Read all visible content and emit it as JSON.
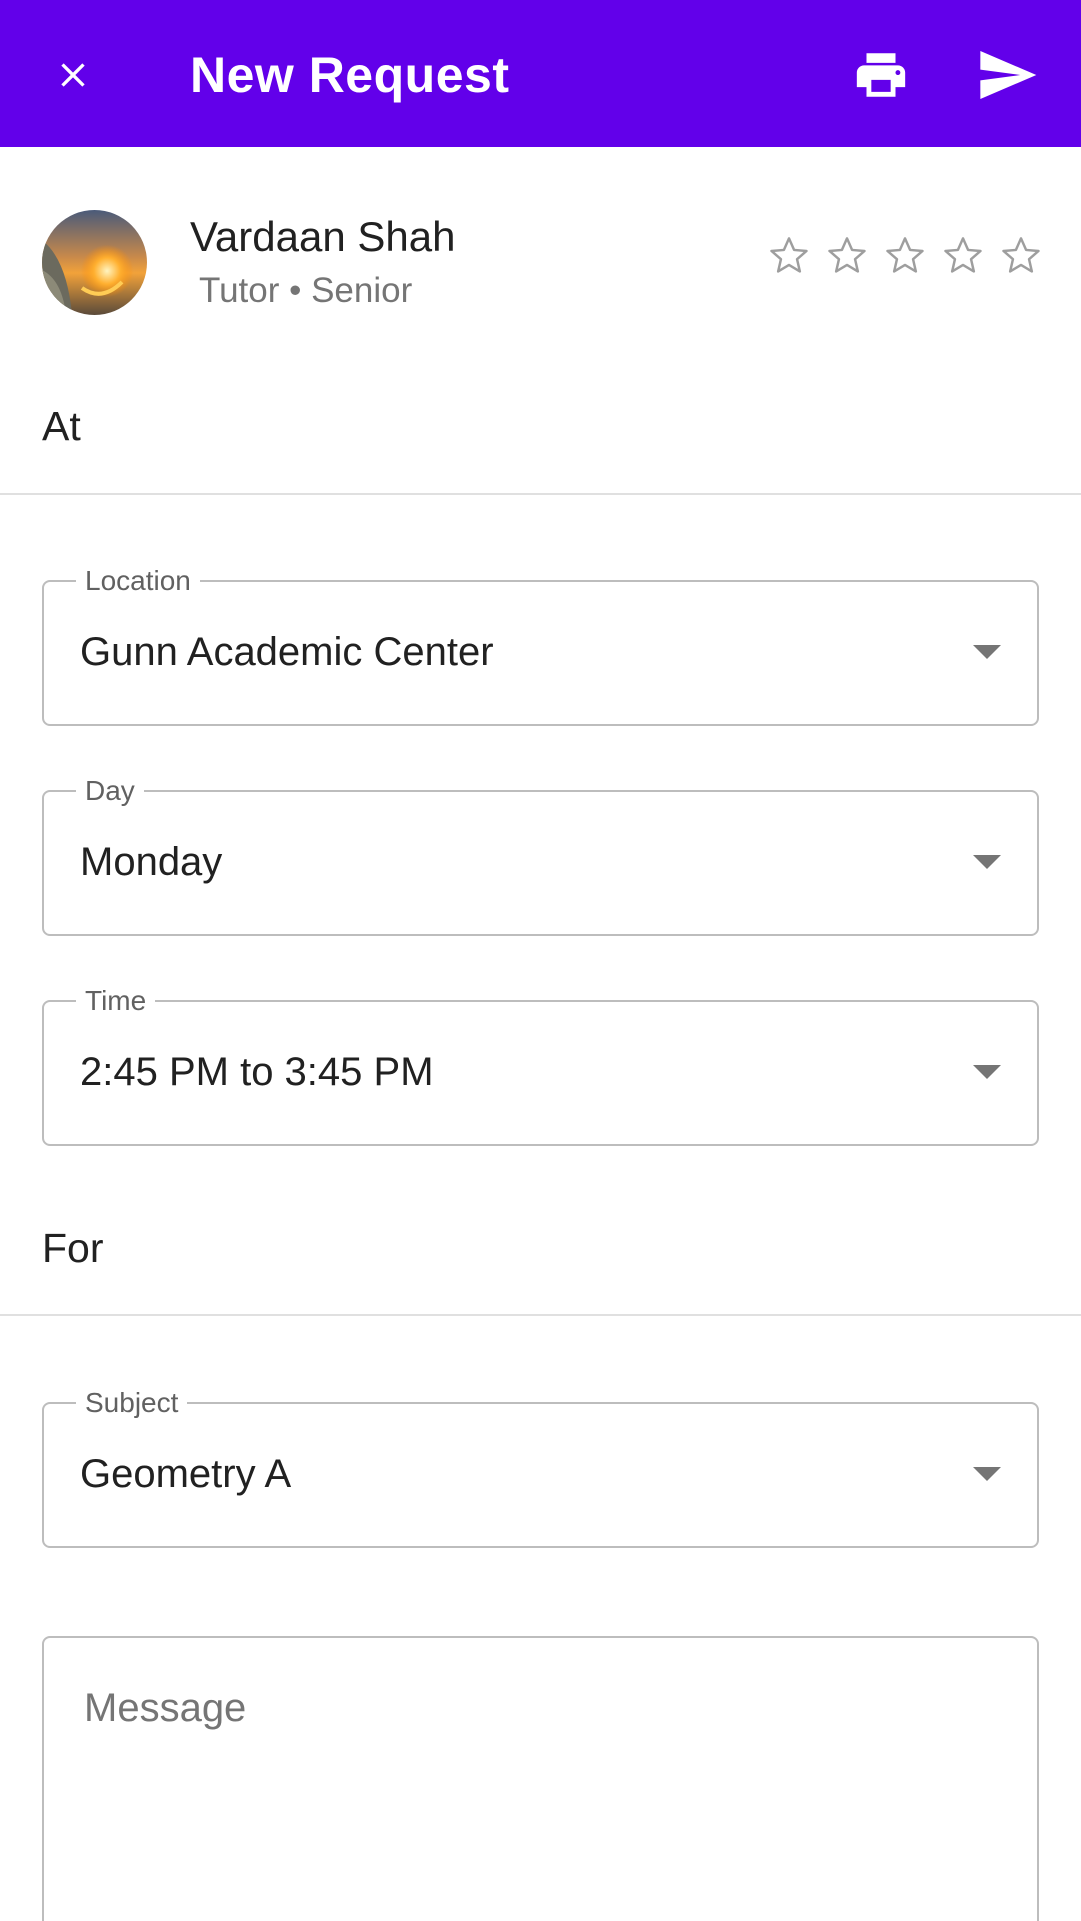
{
  "appbar": {
    "title": "New Request",
    "close_icon": "close-icon",
    "print_icon": "print-icon",
    "send_icon": "send-icon",
    "color": "#6200ea"
  },
  "tutor": {
    "name": "Vardaan Shah",
    "subtitle": "Tutor • Senior",
    "rating": 0,
    "rating_max": 5
  },
  "sections": {
    "at_label": "At",
    "for_label": "For"
  },
  "fields": {
    "location": {
      "label": "Location",
      "value": "Gunn Academic Center"
    },
    "day": {
      "label": "Day",
      "value": "Monday"
    },
    "time": {
      "label": "Time",
      "value": "2:45 PM to 3:45 PM"
    },
    "subject": {
      "label": "Subject",
      "value": "Geometry A"
    }
  },
  "message": {
    "placeholder": "Message",
    "value": ""
  }
}
